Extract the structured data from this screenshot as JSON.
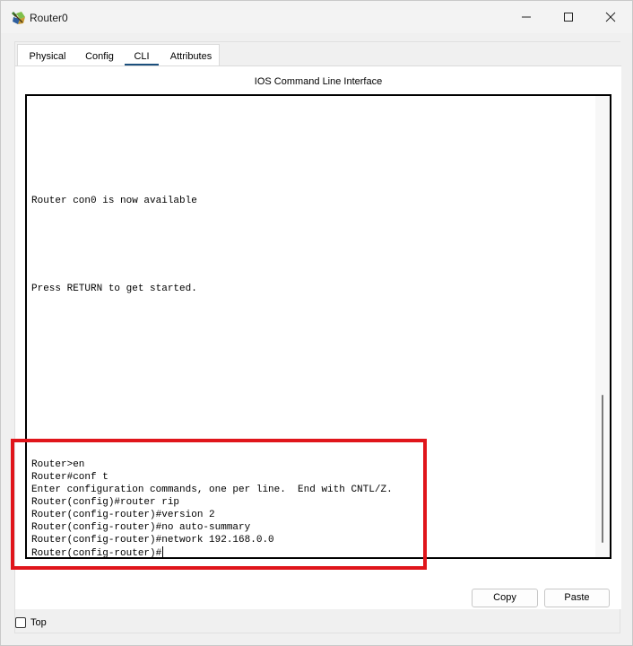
{
  "window": {
    "title": "Router0",
    "icons": {
      "app": "router-icon",
      "minimize": "minimize-icon",
      "maximize": "maximize-icon",
      "close": "close-icon"
    }
  },
  "tabs": [
    {
      "label": "Physical",
      "active": false
    },
    {
      "label": "Config",
      "active": false
    },
    {
      "label": "CLI",
      "active": true
    },
    {
      "label": "Attributes",
      "active": false
    }
  ],
  "cli": {
    "heading": "IOS Command Line Interface",
    "lines": [
      "Router con0 is now available",
      "Press RETURN to get started.",
      "Router>en",
      "Router#conf t",
      "Enter configuration commands, one per line.  End with CNTL/Z.",
      "Router(config)#router rip",
      "Router(config-router)#version 2",
      "Router(config-router)#no auto-summary",
      "Router(config-router)#network 192.168.0.0",
      "Router(config-router)#"
    ]
  },
  "buttons": {
    "copy": "Copy",
    "paste": "Paste"
  },
  "footer": {
    "top_checkbox_label": "Top",
    "top_checked": false
  },
  "colors": {
    "highlight": "#e0151b",
    "tab_indicator": "#1b4f7d"
  }
}
